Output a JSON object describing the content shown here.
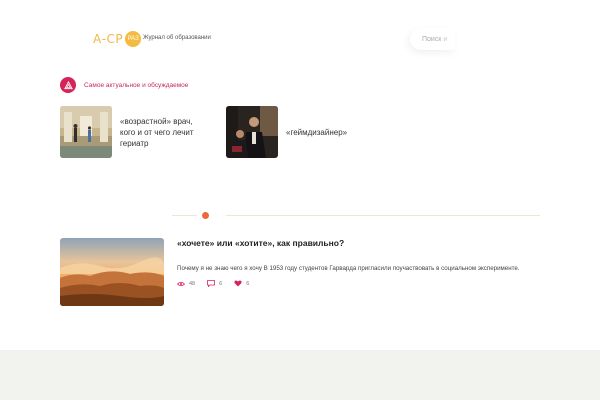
{
  "header": {
    "logo_text": "А-СР",
    "logo_badge": "РАЗ",
    "tagline": "Журнал об образовании",
    "search_placeholder": "Поиск и"
  },
  "section": {
    "title": "Самое актуальное и обсуждаемое",
    "icon": "triangle-icon"
  },
  "trending": [
    {
      "title": "«возрастной» врач, кого и от чего лечит гериатр"
    },
    {
      "title": "«геймдизайнер»"
    }
  ],
  "article": {
    "title": "«хочете» или «хотите», как правильно?",
    "excerpt": "Почему я не знаю чего я хочу В 1953 году студентов Гарварда пригласили поучаствовать в социальном эксперименте.",
    "views": "48",
    "comments": "6",
    "likes": "6"
  },
  "colors": {
    "accent": "#d5245a",
    "logo": "#f3bb3f",
    "divider_dot": "#ec6a3a",
    "footer": "#f2f2ee"
  }
}
